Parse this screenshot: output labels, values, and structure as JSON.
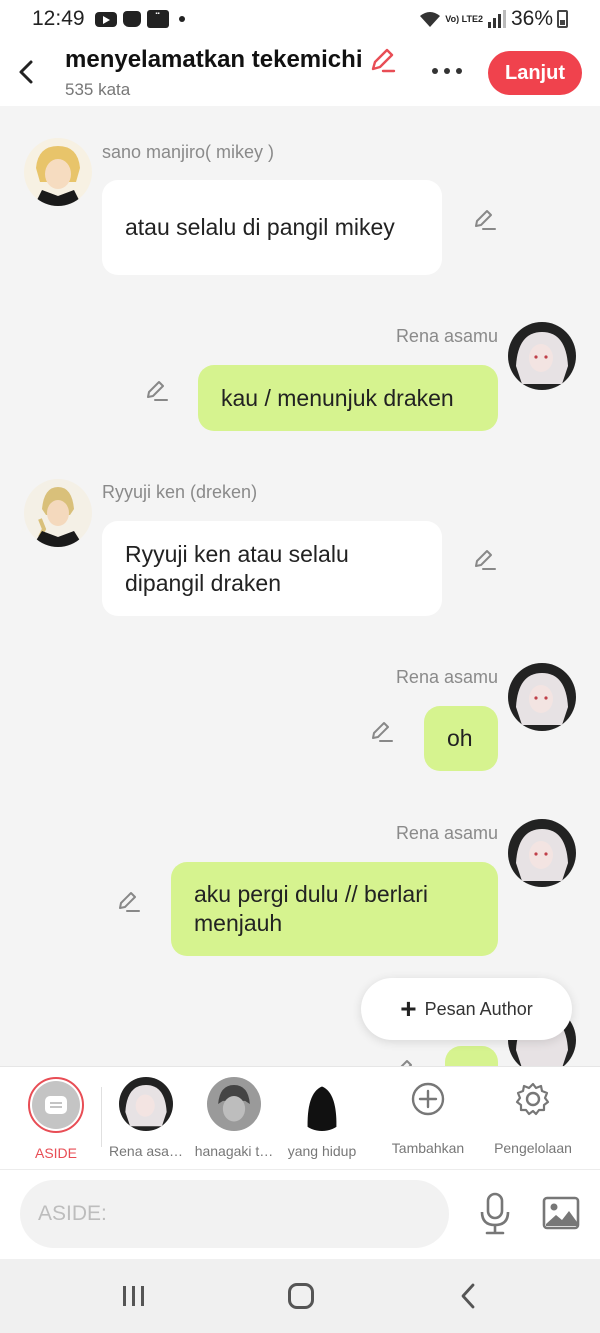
{
  "status_bar": {
    "time": "12:49",
    "battery": "36%",
    "network": "Vo) LTE2"
  },
  "header": {
    "title": "menyelamatkan tekemichi",
    "word_count": "535 kata",
    "next_button": "Lanjut"
  },
  "messages": [
    {
      "side": "left",
      "sender": "sano manjiro( mikey )",
      "text": "atau selalu  di pangil mikey",
      "avatar": "blonde-character-avatar"
    },
    {
      "side": "right",
      "sender": "Rena asamu",
      "text": "kau / menunjuk draken",
      "avatar": "white-hair-character-avatar"
    },
    {
      "side": "left",
      "sender": "Ryyuji ken (dreken)",
      "text": "Ryyuji ken atau selalu dipangil draken",
      "avatar": "braid-character-avatar"
    },
    {
      "side": "right",
      "sender": "Rena asamu",
      "text": "oh",
      "avatar": "white-hair-character-avatar"
    },
    {
      "side": "right",
      "sender": "Rena asamu",
      "text": "aku pergi dulu // berlari menjauh",
      "avatar": "white-hair-character-avatar"
    }
  ],
  "fab": {
    "label": "Pesan Author"
  },
  "characters": [
    {
      "label": "ASIDE"
    },
    {
      "label": "Rena asa…"
    },
    {
      "label": "hanagaki t…"
    },
    {
      "label": "yang hidup"
    },
    {
      "label": "Tambahkan"
    },
    {
      "label": "Pengelolaan"
    }
  ],
  "input": {
    "placeholder": "ASIDE:"
  },
  "colors": {
    "accent": "#f0424d",
    "bubble_right": "#d6f38f",
    "bubble_left": "#ffffff",
    "background": "#f4f4f4"
  }
}
